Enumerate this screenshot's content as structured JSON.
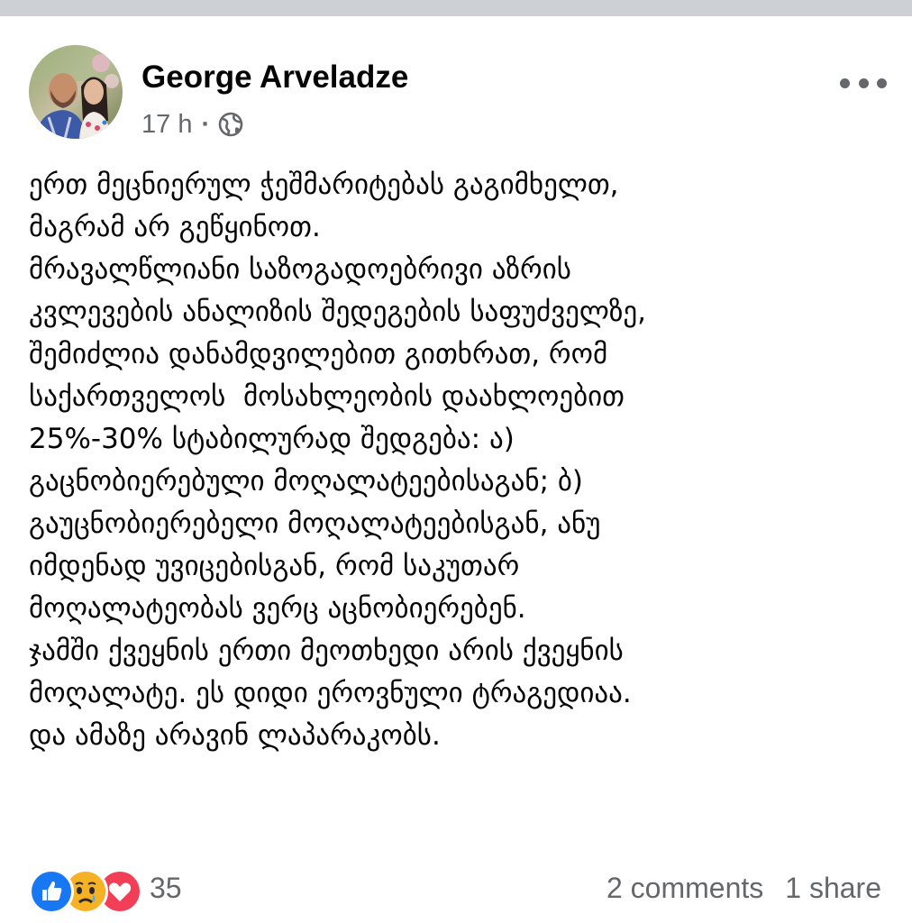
{
  "post": {
    "author_name": "George Arveladze",
    "timestamp": "17 h",
    "separator": "·",
    "audience_icon": "globe-icon",
    "more_icon": "more-options-icon",
    "text": "ერთ მეცნიერულ ჭეშმარიტებას გაგიმხელთ,\nმაგრამ არ გეწყინოთ.\nმრავალწლიანი საზოგადოებრივი აზრის\nკვლევების ანალიზის შედეგების საფუძველზე,\nშემიძლია დანამდვილებით გითხრათ, რომ\nსაქართველოს  მოსახლეობის დაახლოებით\n25%-30% სტაბილურად შედგება: ა)\nგაცნობიერებული მოღალატეებისაგან; ბ)\nგაუცნობიერებელი მოღალატეებისგან, ანუ\nიმდენად უვიცებისგან, რომ საკუთარ\nმოღალატეობას ვერც აცნობიერებენ.\nჯამში ქვეყნის ერთი მეოთხედი არის ქვეყნის\nმოღალატე. ეს დიდი ეროვნული ტრაგედიაა.\nდა ამაზე არავინ ლაპარაკობს."
  },
  "reactions": {
    "icons": [
      "like-icon",
      "sad-icon",
      "love-icon"
    ],
    "count": "35",
    "comments": "2 comments",
    "shares": "1 share"
  },
  "colors": {
    "text": "#050505",
    "secondary": "#65676b",
    "like": "#1877f2",
    "love": "#f33e58",
    "sad": "#f7b125",
    "top_strip": "#cdd0d4"
  }
}
